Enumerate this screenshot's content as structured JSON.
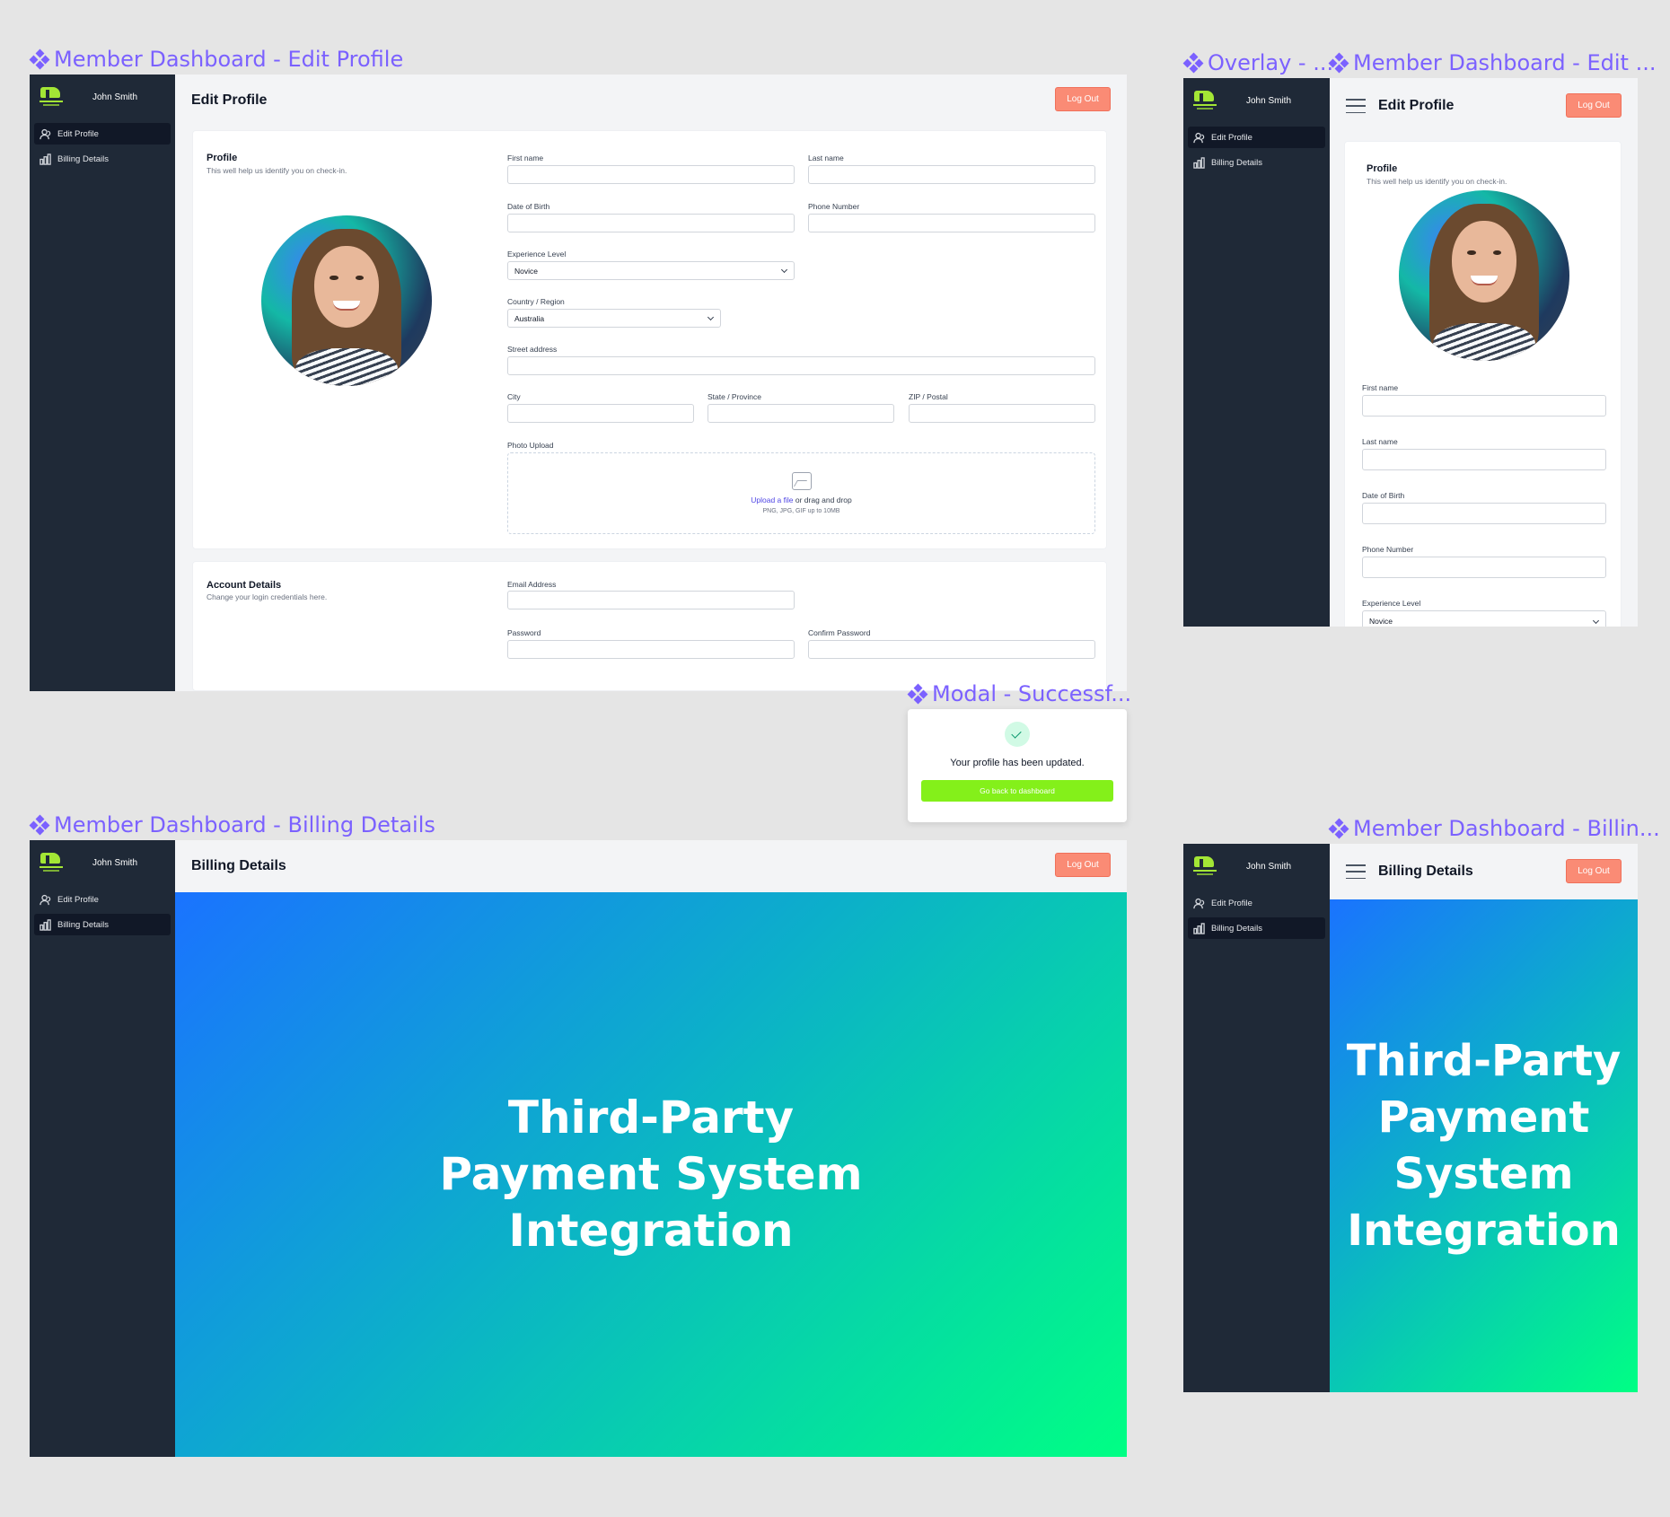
{
  "labels": {
    "edit_profile_desktop": "Member Dashboard - Edit Profile",
    "overlay": "Overlay - ...",
    "edit_profile_mobile": "Member Dashboard - Edit ...",
    "modal": "Modal - Successf...",
    "billing_desktop": "Member Dashboard - Billing Details",
    "billing_mobile": "Member Dashboard - Billin..."
  },
  "sidebar": {
    "user_name": "John Smith",
    "items": [
      {
        "label": "Edit Profile",
        "icon": "user-icon"
      },
      {
        "label": "Billing Details",
        "icon": "chart-icon"
      }
    ]
  },
  "topbar": {
    "edit_title": "Edit Profile",
    "billing_title": "Billing Details",
    "logout_label": "Log Out"
  },
  "profile": {
    "section_title": "Profile",
    "section_desc": "This well help us identify you on check-in.",
    "first_name_label": "First name",
    "last_name_label": "Last name",
    "dob_label": "Date of Birth",
    "phone_label": "Phone Number",
    "experience_label": "Experience Level",
    "experience_value": "Novice",
    "country_label": "Country / Region",
    "country_value": "Australia",
    "street_label": "Street address",
    "city_label": "City",
    "state_label": "State / Province",
    "zip_label": "ZIP / Postal",
    "photo_label": "Photo Upload",
    "upload_link": "Upload a file",
    "upload_rest": " or drag and drop",
    "upload_hint": "PNG, JPG, GIF up to 10MB"
  },
  "account": {
    "section_title": "Account Details",
    "section_desc": "Change your login credentials here.",
    "email_label": "Email Address",
    "password_label": "Password",
    "confirm_label": "Confirm Password"
  },
  "modal": {
    "message": "Your profile has been updated.",
    "button_label": "Go back to dashboard"
  },
  "billing": {
    "placeholder_line1": "Third-Party",
    "placeholder_line2": "Payment System",
    "placeholder_line3": "Integration",
    "mobile_line1": "Third-Party",
    "mobile_line2": "Payment",
    "mobile_line3": "System",
    "mobile_line4": "Integration"
  },
  "colors": {
    "accent": "#7b61ff",
    "sidebar": "#1f2937",
    "logout": "#fa8b75",
    "success_button": "#84f01a",
    "gradient_start": "#1a73ff",
    "gradient_end": "#00ff84"
  }
}
